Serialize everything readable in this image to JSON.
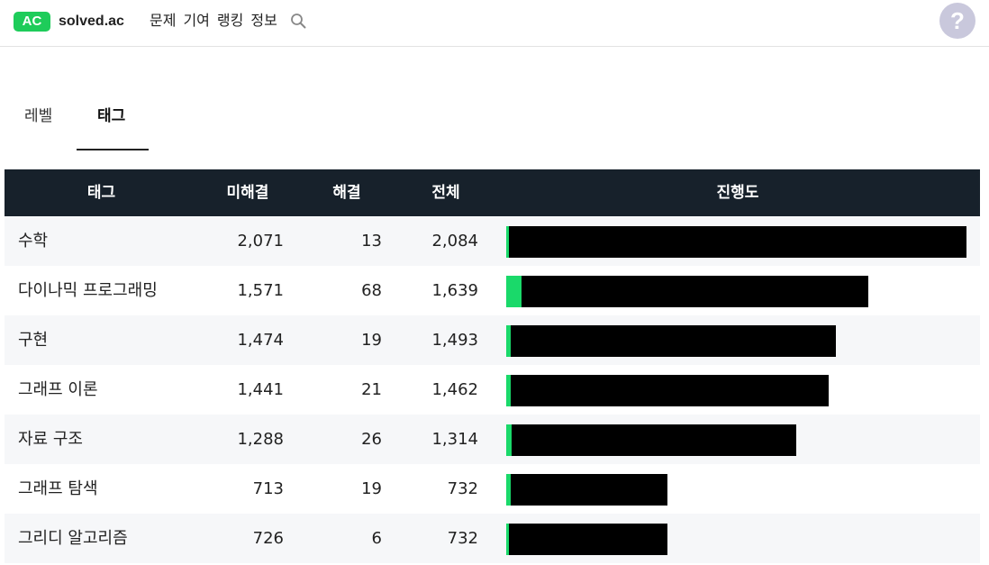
{
  "header": {
    "logo_badge": "AC",
    "logo_text": "solved.ac",
    "nav": [
      "문제",
      "기여",
      "랭킹",
      "정보"
    ],
    "search_icon": "search-icon",
    "help_label": "?"
  },
  "tabs": {
    "level": "레벨",
    "tag": "태그",
    "active": "tag"
  },
  "colors": {
    "accent": "#1ecc5a",
    "progress_fill": "#1ad96a",
    "header_bg": "#17212b",
    "help_bg": "#c9c8dc"
  },
  "table": {
    "headers": {
      "tag": "태그",
      "unsolved": "미해결",
      "solved": "해결",
      "total": "전체",
      "progress": "진행도"
    },
    "rows": [
      {
        "tag": "수학",
        "unsolved": "2,071",
        "solved": "13",
        "total": "2,084"
      },
      {
        "tag": "다이나믹 프로그래밍",
        "unsolved": "1,571",
        "solved": "68",
        "total": "1,639"
      },
      {
        "tag": "구현",
        "unsolved": "1,474",
        "solved": "19",
        "total": "1,493"
      },
      {
        "tag": "그래프 이론",
        "unsolved": "1,441",
        "solved": "21",
        "total": "1,462"
      },
      {
        "tag": "자료 구조",
        "unsolved": "1,288",
        "solved": "26",
        "total": "1,314"
      },
      {
        "tag": "그래프 탐색",
        "unsolved": "713",
        "solved": "19",
        "total": "732"
      },
      {
        "tag": "그리디 알고리즘",
        "unsolved": "726",
        "solved": "6",
        "total": "732"
      }
    ]
  }
}
